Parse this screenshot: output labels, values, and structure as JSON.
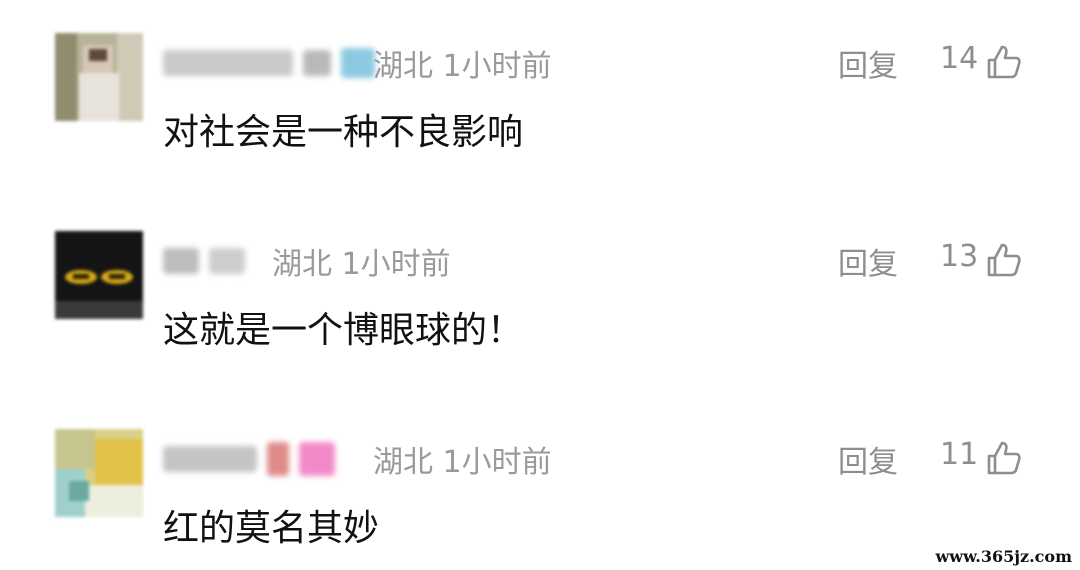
{
  "comments": [
    {
      "location": "湖北",
      "time": "1小时前",
      "content": "对社会是一种不良影响",
      "reply_label": "回复",
      "likes": "14",
      "like_icon": "thumbs-up-icon"
    },
    {
      "location": "湖北",
      "time": "1小时前",
      "content": "这就是一个博眼球的！",
      "reply_label": "回复",
      "likes": "13",
      "like_icon": "thumbs-up-icon"
    },
    {
      "location": "湖北",
      "time": "1小时前",
      "content": "红的莫名其妙",
      "reply_label": "回复",
      "likes": "11",
      "like_icon": "thumbs-up-icon"
    }
  ],
  "watermark": "www.365jz.com",
  "colors": {
    "meta_text": "#9a9a9a",
    "content_text": "#111111",
    "background": "#ffffff"
  }
}
